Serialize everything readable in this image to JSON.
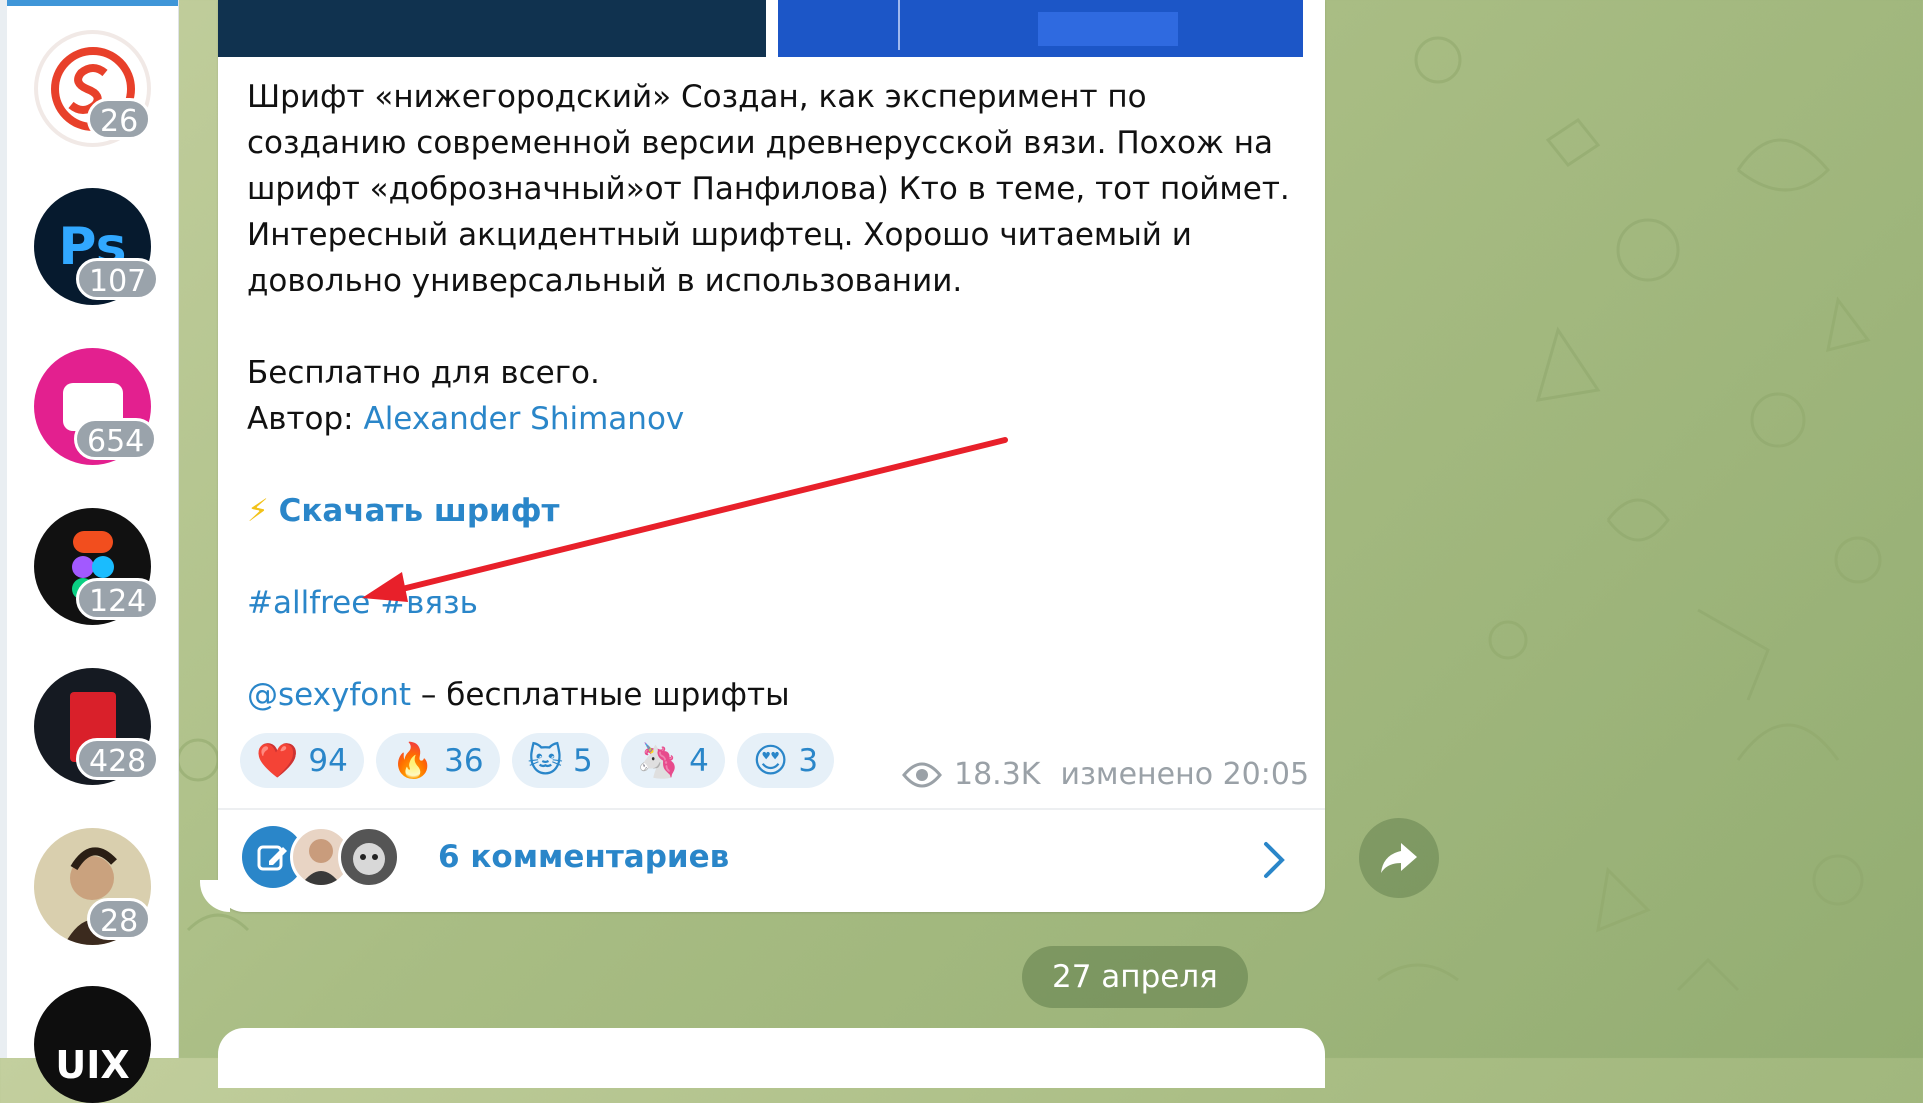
{
  "sidebar": {
    "chats": [
      {
        "name": "sexyfont-channel",
        "badge": "26"
      },
      {
        "name": "photoshop-channel",
        "badge": "107",
        "avatar_text": "Ps"
      },
      {
        "name": "pink-channel",
        "badge": "654"
      },
      {
        "name": "figma-channel",
        "badge": "124"
      },
      {
        "name": "red-channel",
        "badge": "428"
      },
      {
        "name": "portrait-channel",
        "badge": "28"
      },
      {
        "name": "uix-channel",
        "avatar_text": "UIX"
      }
    ]
  },
  "message": {
    "paragraph1": "Шрифт «нижегородский» Создан, как эксперимент по созданию современной версии древнерусской вязи. Похож на шрифт «доброзначный»от Панфилова) Кто в теме, тот поймет. Интересный акцидентный шрифтец. Хорошо читаемый и довольно универсальный в использовании.",
    "free_line": "Бесплатно для всего.",
    "author_label": "Автор: ",
    "author_name": "Alexander Shimanov",
    "download_icon": "⚡",
    "download_label": "Скачать шрифт",
    "hashtag1": "#allfree",
    "hashtag2": "#вязь",
    "channel_mention": "@sexyfont",
    "channel_suffix": " – бесплатные шрифты",
    "reactions": [
      {
        "emoji": "❤️",
        "count": "94"
      },
      {
        "emoji": "🔥",
        "count": "36"
      },
      {
        "emoji": "🐱",
        "count": "5"
      },
      {
        "emoji": "🦄",
        "count": "4"
      },
      {
        "emoji": "😍",
        "count": "3"
      }
    ],
    "views": "18.3K",
    "edited": "изменено 20:05",
    "comments_label": "6 комментариев"
  },
  "date_separator": "27 апреля",
  "colors": {
    "link": "#2a86c9",
    "arrow": "#e8202a",
    "reaction_bg": "#e6f0f8"
  }
}
